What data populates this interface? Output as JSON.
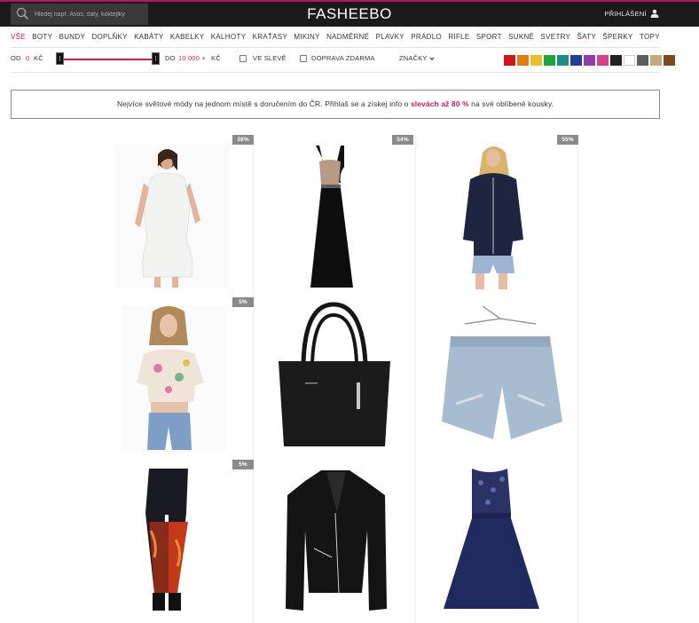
{
  "header": {
    "search_placeholder": "Hledej např. Asos, šaty, koktejlky",
    "logo": "FASHEEBO",
    "login_label": "PŘIHLÁŠENÍ"
  },
  "categories": [
    "VŠE",
    "BOTY",
    "BUNDY",
    "DOPLŇKY",
    "KABÁTY",
    "KABELKY",
    "KALHOTY",
    "KRAŤASY",
    "MIKINY",
    "NADMĚRNÉ",
    "PLAVKY",
    "PRÁDLO",
    "RIFLE",
    "SPORT",
    "SUKNĚ",
    "SVETRY",
    "ŠATY",
    "ŠPERKY",
    "TOPY"
  ],
  "filters": {
    "from_label": "OD",
    "from_value": "0",
    "currency": "KČ",
    "to_label": "DO",
    "to_value": "10 000 +",
    "sale_label": "VE SLEVĚ",
    "free_shipping_label": "DOPRAVA ZDARMA",
    "brands_label": "ZNAČKY"
  },
  "colors": [
    "#d1141d",
    "#e07d1b",
    "#e6c02b",
    "#1fa23a",
    "#1c8d8a",
    "#243e9a",
    "#8c3fa8",
    "#d3408d",
    "#222222",
    "#ffffff",
    "#5e5e5e",
    "#c5a97a",
    "#7b4a23"
  ],
  "banner": {
    "prefix": "Nejvíce světové módy na jednom místě s doručením do ČR. Přihlaš se a získej info o",
    "highlight": "slevách až 80 %",
    "suffix": "na své oblíbené kousky."
  },
  "products": [
    {
      "name": "white-dress",
      "badge": "38%"
    },
    {
      "name": "black-maxi-dress",
      "badge": "54%"
    },
    {
      "name": "navy-hoodie",
      "badge": "55%"
    },
    {
      "name": "floral-crop-top",
      "badge": "5%"
    },
    {
      "name": "black-handbag",
      "badge": ""
    },
    {
      "name": "denim-shorts",
      "badge": ""
    },
    {
      "name": "galaxy-leggings",
      "badge": "5%"
    },
    {
      "name": "black-jacket",
      "badge": ""
    },
    {
      "name": "navy-lace-dress",
      "badge": ""
    }
  ]
}
